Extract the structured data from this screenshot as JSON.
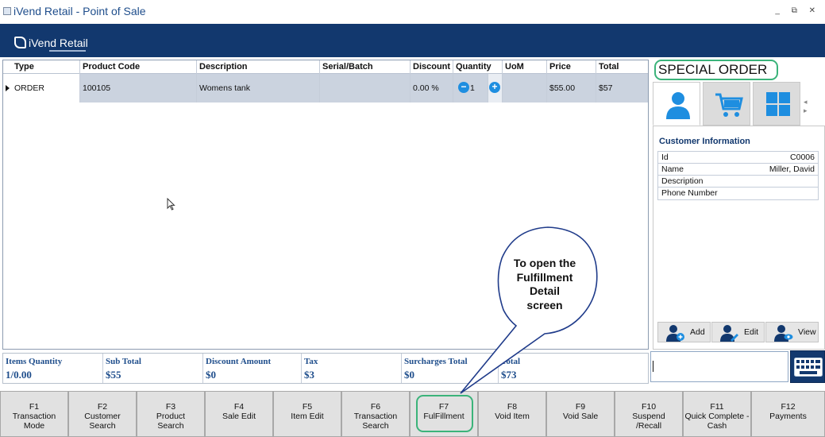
{
  "window": {
    "title": "iVend Retail - Point of Sale",
    "controls": "_ ⧉ ✕"
  },
  "brand": {
    "logo_text": "iVend Retail"
  },
  "grid": {
    "columns": [
      "Type",
      "Product Code",
      "Description",
      "Serial/Batch",
      "Discount",
      "Quantity",
      "UoM",
      "Price",
      "Total"
    ],
    "rows": [
      {
        "type": "ORDER",
        "product_code": "100105",
        "description": "Womens tank",
        "serial_batch": "",
        "discount": "0.00 %",
        "quantity": "1",
        "uom": "",
        "price": "$55.00",
        "total": "$57"
      }
    ]
  },
  "right_panel": {
    "mode_label": "SPECIAL ORDER",
    "tabs": [
      {
        "icon": "customer-icon",
        "active": true
      },
      {
        "icon": "cart-icon",
        "active": false
      },
      {
        "icon": "tiles-icon",
        "active": false
      }
    ],
    "tab_arrows": "◂ ▸",
    "customer_info_title": "Customer Information",
    "customer_fields": [
      {
        "key": "Id",
        "value": "C0006"
      },
      {
        "key": "Name",
        "value": "Miller, David"
      },
      {
        "key": "Description",
        "value": ""
      },
      {
        "key": "Phone Number",
        "value": ""
      }
    ],
    "actions": [
      {
        "label": "Add",
        "icon": "add-customer-icon"
      },
      {
        "label": "Edit",
        "icon": "edit-customer-icon"
      },
      {
        "label": "View",
        "icon": "view-customer-icon"
      }
    ]
  },
  "totals": [
    {
      "label": "Items Quantity",
      "value": "1/0.00"
    },
    {
      "label": "Sub Total",
      "value": "$55"
    },
    {
      "label": "Discount Amount",
      "value": "$0"
    },
    {
      "label": "Tax",
      "value": "$3"
    },
    {
      "label": "Surcharges Total",
      "value": "$0"
    },
    {
      "label": "Total",
      "value": "$73"
    }
  ],
  "scan_input": {
    "value": ""
  },
  "function_keys": [
    {
      "code": "F1",
      "label_1": "Transaction",
      "label_2": "Mode"
    },
    {
      "code": "F2",
      "label_1": "Customer",
      "label_2": "Search"
    },
    {
      "code": "F3",
      "label_1": "Product",
      "label_2": "Search"
    },
    {
      "code": "F4",
      "label_1": "Sale Edit",
      "label_2": ""
    },
    {
      "code": "F5",
      "label_1": "Item Edit",
      "label_2": ""
    },
    {
      "code": "F6",
      "label_1": "Transaction",
      "label_2": "Search"
    },
    {
      "code": "F7",
      "label_1": "FulFillment",
      "label_2": ""
    },
    {
      "code": "F8",
      "label_1": "Void Item",
      "label_2": ""
    },
    {
      "code": "F9",
      "label_1": "Void Sale",
      "label_2": ""
    },
    {
      "code": "F10",
      "label_1": "Suspend",
      "label_2": "/Recall"
    },
    {
      "code": "F11",
      "label_1": "Quick Complete -",
      "label_2": "Cash"
    },
    {
      "code": "F12",
      "label_1": "Payments",
      "label_2": ""
    }
  ],
  "callout": {
    "lines": [
      "To open the",
      "Fulfillment",
      "Detail",
      "screen"
    ]
  },
  "colors": {
    "brand_bar": "#12386e",
    "accent_blue": "#1e8ee0",
    "highlight_green": "#3bb37a",
    "selected_row": "#cbd3df",
    "fkey_bg": "#e1e1e1"
  }
}
